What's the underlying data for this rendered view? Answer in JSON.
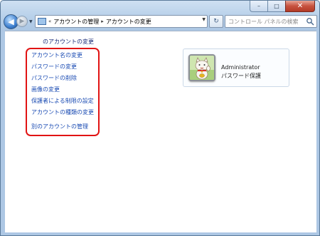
{
  "window": {
    "minimize_glyph": "–",
    "maximize_glyph": "□",
    "close_glyph": "✕"
  },
  "nav": {
    "back_glyph": "◀",
    "forward_glyph": "▶",
    "dropdown_glyph": "▼"
  },
  "address": {
    "overflow": "«",
    "crumbs": [
      "アカウントの管理",
      "アカウントの変更"
    ],
    "separator": "▸",
    "dropdown_glyph": "▼",
    "refresh_glyph": "↻"
  },
  "search": {
    "placeholder": "コントロール パネルの検索"
  },
  "main": {
    "heading": "のアカウントの変更",
    "tasks": [
      "アカウント名の変更",
      "パスワードの変更",
      "パスワードの削除",
      "画像の変更",
      "保護者による制限の設定",
      "アカウントの種類の変更",
      "別のアカウントの管理"
    ],
    "highlight_color": "#e11313",
    "link_color": "#1a4bb3"
  },
  "account": {
    "name": "Administrator",
    "type": "パスワード保護",
    "picture_icon": "lucky-cat-icon"
  }
}
